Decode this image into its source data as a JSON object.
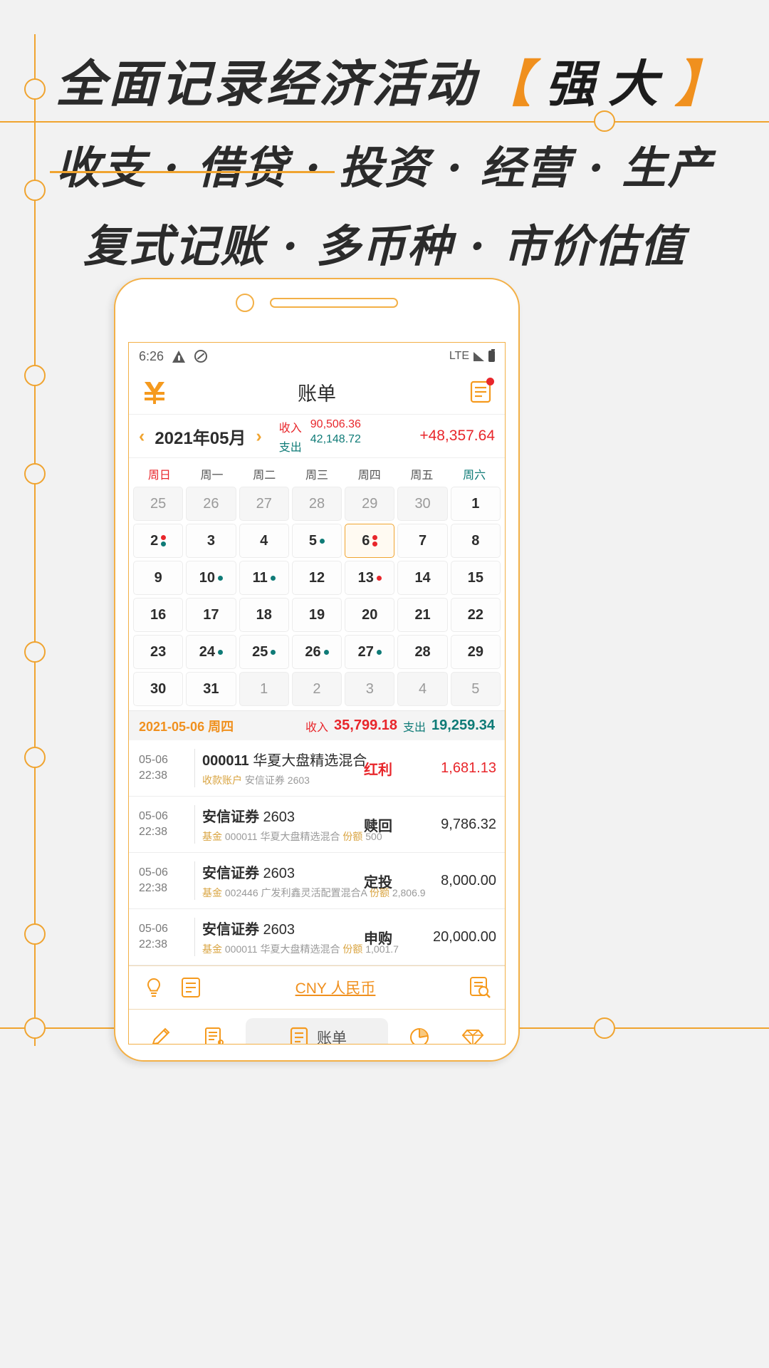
{
  "hero": {
    "line1_main": "全面记录经济活动",
    "bracket_left": "【",
    "line1_strong": "强大",
    "bracket_right": "】",
    "line2": "收支 · 借贷 · 投资 · 经营 · 生产",
    "line3": "复式记账 · 多币种 · 市价估值",
    "accent_color": "#f0a430"
  },
  "statusbar": {
    "time": "6:26",
    "network": "LTE",
    "warn_icon": "warning-icon",
    "dnd_icon": "do-not-disturb-icon",
    "signal_icon": "signal-icon",
    "battery_icon": "battery-icon"
  },
  "header": {
    "title": "账单",
    "logo_icon": "app-logo-icon",
    "action_icon": "document-icon",
    "badge": true
  },
  "month": {
    "prev_arrow": "‹",
    "next_arrow": "›",
    "label": "2021年05月",
    "income_label": "收入",
    "income_value": "90,506.36",
    "expense_label": "支出",
    "expense_value": "42,148.72",
    "net_value": "+48,357.64",
    "income_color": "#e8262b",
    "expense_color": "#0f7b77"
  },
  "calendar": {
    "weekdays": [
      "周日",
      "周一",
      "周二",
      "周三",
      "周四",
      "周五",
      "周六"
    ],
    "cells": [
      {
        "d": "25",
        "grey": true
      },
      {
        "d": "26",
        "grey": true
      },
      {
        "d": "27",
        "grey": true
      },
      {
        "d": "28",
        "grey": true
      },
      {
        "d": "29",
        "grey": true
      },
      {
        "d": "30",
        "grey": true
      },
      {
        "d": "1"
      },
      {
        "d": "2",
        "dots": [
          "red",
          "teal"
        ]
      },
      {
        "d": "3"
      },
      {
        "d": "4"
      },
      {
        "d": "5",
        "dots": [
          "teal"
        ]
      },
      {
        "d": "6",
        "selected": true,
        "dots": [
          "red",
          "red"
        ]
      },
      {
        "d": "7"
      },
      {
        "d": "8"
      },
      {
        "d": "9"
      },
      {
        "d": "10",
        "dots": [
          "teal"
        ]
      },
      {
        "d": "11",
        "dots": [
          "teal"
        ]
      },
      {
        "d": "12"
      },
      {
        "d": "13",
        "dots": [
          "red"
        ]
      },
      {
        "d": "14"
      },
      {
        "d": "15"
      },
      {
        "d": "16"
      },
      {
        "d": "17"
      },
      {
        "d": "18"
      },
      {
        "d": "19"
      },
      {
        "d": "20"
      },
      {
        "d": "21"
      },
      {
        "d": "22"
      },
      {
        "d": "23"
      },
      {
        "d": "24",
        "dots": [
          "teal"
        ]
      },
      {
        "d": "25",
        "dots": [
          "teal"
        ]
      },
      {
        "d": "26",
        "dots": [
          "teal"
        ]
      },
      {
        "d": "27",
        "dots": [
          "teal"
        ]
      },
      {
        "d": "28"
      },
      {
        "d": "29"
      },
      {
        "d": "30"
      },
      {
        "d": "31"
      },
      {
        "d": "1",
        "grey": true
      },
      {
        "d": "2",
        "grey": true
      },
      {
        "d": "3",
        "grey": true
      },
      {
        "d": "4",
        "grey": true
      },
      {
        "d": "5",
        "grey": true
      }
    ]
  },
  "day_summary": {
    "date": "2021-05-06 周四",
    "income_label": "收入",
    "income_value": "35,799.18",
    "expense_label": "支出",
    "expense_value": "19,259.34"
  },
  "transactions": [
    {
      "date": "05-06",
      "time": "22:38",
      "title_code": "000011",
      "title_name": "华夏大盘精选混合",
      "sub_tag": "收款账户",
      "sub_text": "安信证券 2603",
      "sub_tag2": "",
      "sub_text2": "",
      "kind": "红利",
      "kind_color": "red",
      "amount": "1,681.13",
      "amount_color": "red"
    },
    {
      "date": "05-06",
      "time": "22:38",
      "title_code": "安信证券",
      "title_name": "2603",
      "sub_tag": "基金",
      "sub_text": "000011 华夏大盘精选混合",
      "sub_tag2": "份额",
      "sub_text2": "500",
      "kind": "赎回",
      "kind_color": "dark",
      "amount": "9,786.32",
      "amount_color": "dark"
    },
    {
      "date": "05-06",
      "time": "22:38",
      "title_code": "安信证券",
      "title_name": "2603",
      "sub_tag": "基金",
      "sub_text": "002446 广发利鑫灵活配置混合A",
      "sub_tag2": "份额",
      "sub_text2": "2,806.9",
      "kind": "定投",
      "kind_color": "dark",
      "amount": "8,000.00",
      "amount_color": "dark"
    },
    {
      "date": "05-06",
      "time": "22:38",
      "title_code": "安信证券",
      "title_name": "2603",
      "sub_tag": "基金",
      "sub_text": "000011 华夏大盘精选混合",
      "sub_tag2": "份额",
      "sub_text2": "1,001.7",
      "kind": "申购",
      "kind_color": "dark",
      "amount": "20,000.00",
      "amount_color": "dark"
    }
  ],
  "currency_bar": {
    "left_icon": "lightbulb-icon",
    "left_icon2": "note-icon",
    "label": "CNY 人民币",
    "right_icon": "search-document-icon"
  },
  "tabbar": {
    "items": [
      {
        "icon": "edit-icon",
        "label": "",
        "active": false
      },
      {
        "icon": "ledger-icon",
        "label": "",
        "active": false
      },
      {
        "icon": "bill-icon",
        "label": "账单",
        "active": true
      },
      {
        "icon": "pie-chart-icon",
        "label": "",
        "active": false
      },
      {
        "icon": "diamond-icon",
        "label": "",
        "active": false
      }
    ]
  }
}
